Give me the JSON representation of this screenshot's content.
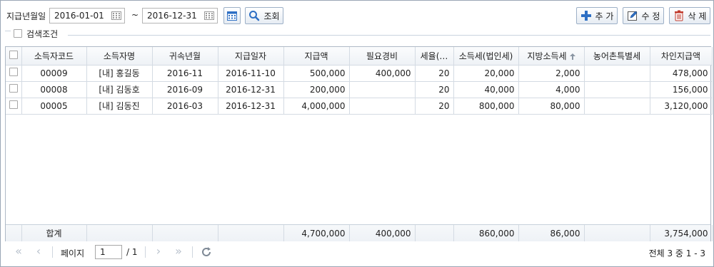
{
  "toolbar": {
    "pay_period_label": "지급년월일",
    "date_from": "2016-01-01",
    "tilde": "~",
    "date_to": "2016-12-31",
    "search_label": "조회",
    "add_label": "추 가",
    "edit_label": "수 정",
    "delete_label": "삭 제"
  },
  "condition": {
    "label": "검색조건"
  },
  "grid": {
    "columns": [
      "소득자코드",
      "소득자명",
      "귀속년월",
      "지급일자",
      "지급액",
      "필요경비",
      "세율(…",
      "소득세(법인세)",
      "지방소득세",
      "농어촌특별세",
      "차인지급액"
    ],
    "rows": [
      [
        "00009",
        "[내] 홍길동",
        "2016-11",
        "2016-11-10",
        "500,000",
        "400,000",
        "20",
        "20,000",
        "2,000",
        "",
        "478,000"
      ],
      [
        "00008",
        "[내] 김동호",
        "2016-09",
        "2016-12-31",
        "200,000",
        "",
        "20",
        "40,000",
        "4,000",
        "",
        "156,000"
      ],
      [
        "00005",
        "[내] 김동진",
        "2016-03",
        "2016-12-31",
        "4,000,000",
        "",
        "20",
        "800,000",
        "80,000",
        "",
        "3,120,000"
      ]
    ],
    "summary": {
      "label": "합계",
      "pay_amount": "4,700,000",
      "expense": "400,000",
      "income_tax": "860,000",
      "local_tax": "86,000",
      "net_pay": "3,754,000"
    }
  },
  "pager": {
    "page_label": "페이지",
    "current_page": "1",
    "total_pages": "/ 1",
    "info": "전체 3 중 1 - 3"
  },
  "colors": {
    "accent_blue": "#2e6fc4",
    "delete_red": "#c0392b",
    "border": "#9aa6b5"
  }
}
